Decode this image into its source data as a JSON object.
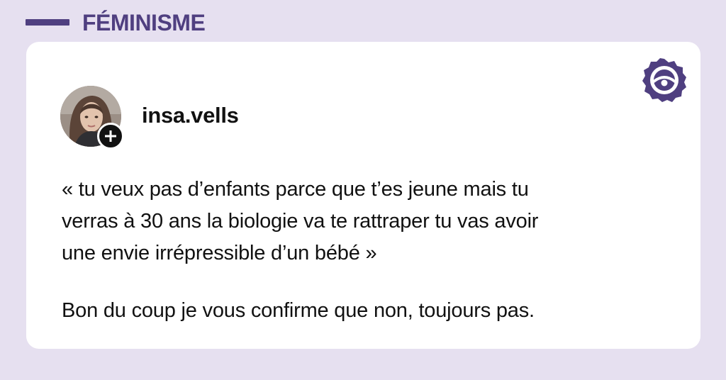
{
  "category": {
    "label": "FÉMINISME",
    "color": "#4f3f80"
  },
  "background_color": "#e6e0f0",
  "brand": {
    "icon": "eye-badge-icon",
    "color": "#4f3f80"
  },
  "post": {
    "author": {
      "username": "insa.vells",
      "avatar_icon": "avatar",
      "follow_icon": "plus-icon"
    },
    "quote": "« tu veux pas d’enfants parce que t’es jeune mais tu\nverras à 30 ans la biologie va te rattraper tu vas avoir\nune envie irrépressible d’un bébé »",
    "reply": "Bon du coup je vous confirme que non, toujours pas."
  }
}
